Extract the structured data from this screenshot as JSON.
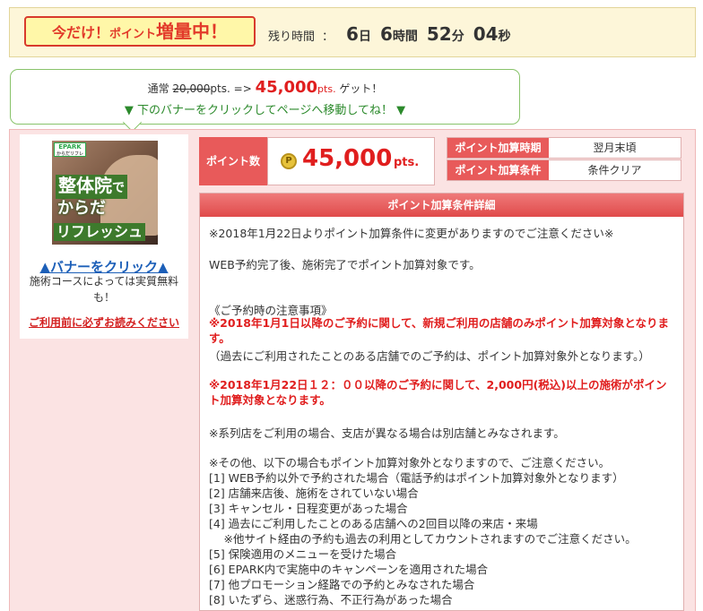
{
  "campaign": {
    "badge_part1": "今だけ！",
    "badge_part2": "ポイント",
    "badge_part3": "増量中！",
    "remaining_label": "残り時間",
    "remaining_sep": "：",
    "days": "6",
    "days_unit": "日",
    "hours": "6",
    "hours_unit": "時間",
    "minutes": "52",
    "minutes_unit": "分",
    "seconds": "04",
    "seconds_unit": "秒"
  },
  "bubble": {
    "normal_label": "通常",
    "old_points": "20,000",
    "old_unit": "pts.",
    "arrow": "=>",
    "new_points": "45,000",
    "new_unit": "pts.",
    "get": "ゲット！",
    "instruction": "▼ 下のバナーをクリックしてページへ移動してね！ ▼"
  },
  "banner": {
    "epark": "EPARK",
    "epark_sub": "からだリフレ",
    "line1": "整体院",
    "line1_small": "で",
    "line2": "からだ",
    "line3": "リフレッシュ"
  },
  "left": {
    "click_link": "▲バナーをクリック▲",
    "note": "施術コースによっては実質無料も！",
    "read_first": "ご利用前に必ずお読みください"
  },
  "points": {
    "label": "ポイント数",
    "coin": "P",
    "value": "45,000",
    "unit": "pts."
  },
  "info": {
    "rows": [
      {
        "header": "ポイント加算時期",
        "value": "翌月末頃"
      },
      {
        "header": "ポイント加算条件",
        "value": "条件クリア"
      }
    ]
  },
  "detail": {
    "title": "ポイント加算条件詳細",
    "notice": "※2018年1月22日よりポイント加算条件に変更がありますのでご注意ください※",
    "web": "WEB予約完了後、施術完了でポイント加算対象です。",
    "caution_title": "《ご予約時の注意事項》",
    "red1": "※2018年1月1日以降のご予約に関して、新規ご利用の店舗のみポイント加算対象となります。",
    "sub1": "（過去にご利用されたことのある店舗でのご予約は、ポイント加算対象外となります。）",
    "red2": "※2018年1月22日１２：００以降のご予約に関して、2,000円(税込)以上の施術がポイント加算対象となります。",
    "branch": "※系列店をご利用の場合、支店が異なる場合は別店舗とみなされます。",
    "other": "※その他、以下の場合もポイント加算対象外となりますので、ご注意ください。",
    "items": [
      "[1] WEB予約以外で予約された場合（電話予約はポイント加算対象外となります）",
      "[2] 店舗来店後、施術をされていない場合",
      "[3] キャンセル・日程変更があった場合",
      "[4] 過去にご利用したことのある店舗への2回目以降の来店・来場",
      "　 ※他サイト経由の予約も過去の利用としてカウントされますのでご注意ください。",
      "[5] 保険適用のメニューを受けた場合",
      "[6] EPARK内で実施中のキャンペーンを適用された場合",
      "[7] 他プロモーション経路での予約とみなされた場合",
      "[8] いたずら、迷惑行為、不正行為があった場合"
    ]
  }
}
